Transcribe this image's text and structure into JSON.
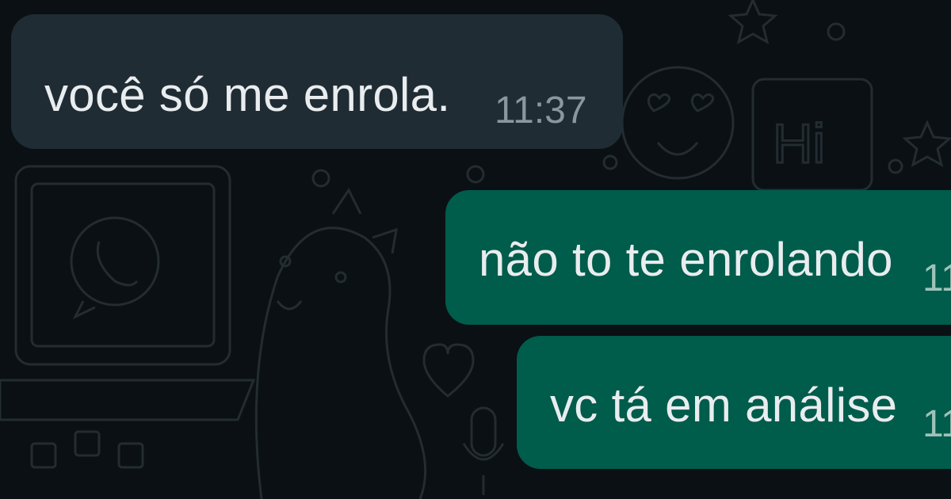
{
  "chat": {
    "messages": [
      {
        "direction": "incoming",
        "text": "você só me enrola.",
        "time": "11:37"
      },
      {
        "direction": "outgoing",
        "text": "não to te enrolando",
        "time": "11"
      },
      {
        "direction": "outgoing",
        "text": "vc tá em análise",
        "time": "11"
      }
    ]
  },
  "doodle_text": "Hi",
  "colors": {
    "background": "#0b1014",
    "incoming_bubble": "#1f2c34",
    "outgoing_bubble": "#005c4b",
    "message_text": "#e9edef",
    "timestamp": "#8b969d"
  }
}
